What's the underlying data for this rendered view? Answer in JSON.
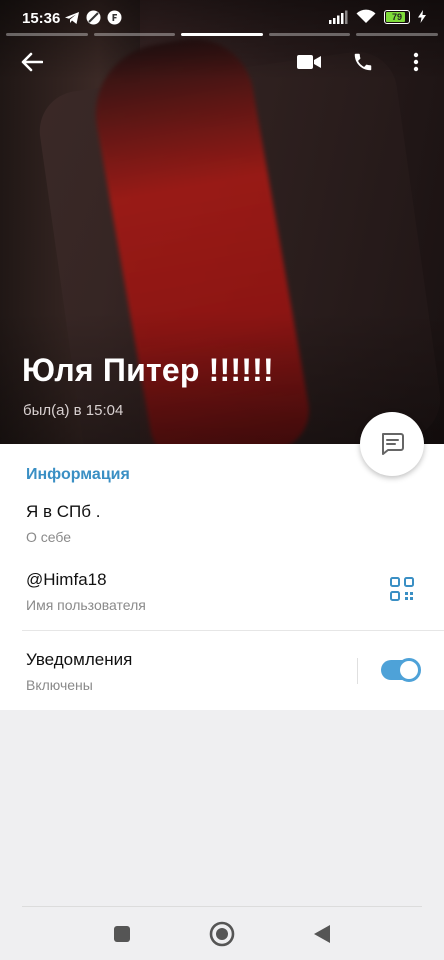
{
  "status_bar": {
    "time": "15:36",
    "battery_level": "79",
    "icons": [
      "telegram-icon",
      "blocked-icon",
      "f-badge-icon",
      "signal-icon",
      "wifi-icon",
      "battery-icon",
      "charging-icon"
    ]
  },
  "story_progress": {
    "segments": 5,
    "active_index": 1
  },
  "toolbar": {
    "back_icon": "arrow-left-icon",
    "video_call_icon": "video-camera-icon",
    "call_icon": "phone-icon",
    "more_icon": "more-vertical-icon"
  },
  "profile": {
    "name": "Юля Питер !!!!!!",
    "last_seen": "был(а) в 15:04"
  },
  "info": {
    "section_title": "Информация",
    "bio_value": "Я в СПб .",
    "bio_label": "О себе",
    "username_value": "@Himfa18",
    "username_label": "Имя пользователя",
    "notifications_title": "Уведомления",
    "notifications_status": "Включены",
    "notifications_enabled": true
  },
  "colors": {
    "accent": "#3a8fc4",
    "toggle": "#4ea2d8",
    "battery_fill": "#7fdc3a",
    "background": "#efeff1"
  }
}
